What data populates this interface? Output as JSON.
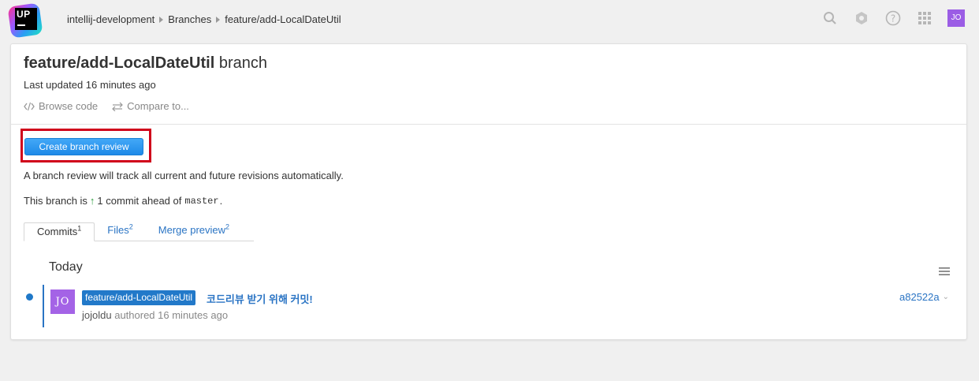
{
  "app": {
    "logo_text": "UP",
    "breadcrumb": [
      "intellij-development",
      "Branches",
      "feature/add-LocalDateUtil"
    ],
    "user_initials": "JO",
    "top_icons": [
      "search-icon",
      "settings-icon",
      "help-icon",
      "apps-grid-icon"
    ]
  },
  "branch": {
    "name": "feature/add-LocalDateUtil",
    "suffix": "branch",
    "last_updated": "Last updated 16 minutes ago",
    "browse_code": "Browse code",
    "compare_to": "Compare to...",
    "create_button": "Create branch review",
    "review_note": "A branch review will track all current and future revisions automatically.",
    "ahead_prefix": "This branch is",
    "ahead_text": "1 commit ahead of",
    "ahead_target": "master",
    "ahead_suffix": "."
  },
  "tabs": [
    {
      "label": "Commits",
      "count": "1",
      "active": true
    },
    {
      "label": "Files",
      "count": "2",
      "active": false
    },
    {
      "label": "Merge preview",
      "count": "2",
      "active": false
    }
  ],
  "commits": {
    "group_label": "Today",
    "items": [
      {
        "avatar": "JO",
        "branch_tag": "feature/add-LocalDateUtil",
        "message": "코드리뷰 받기 위해 커밋!",
        "author": "jojoldu",
        "meta": "authored 16 minutes ago",
        "hash": "a82522a"
      }
    ]
  },
  "colors": {
    "accent": "#2a74c4",
    "button": "#1e8ae8",
    "highlight": "#d0021b",
    "avatar": "#a463e6"
  }
}
